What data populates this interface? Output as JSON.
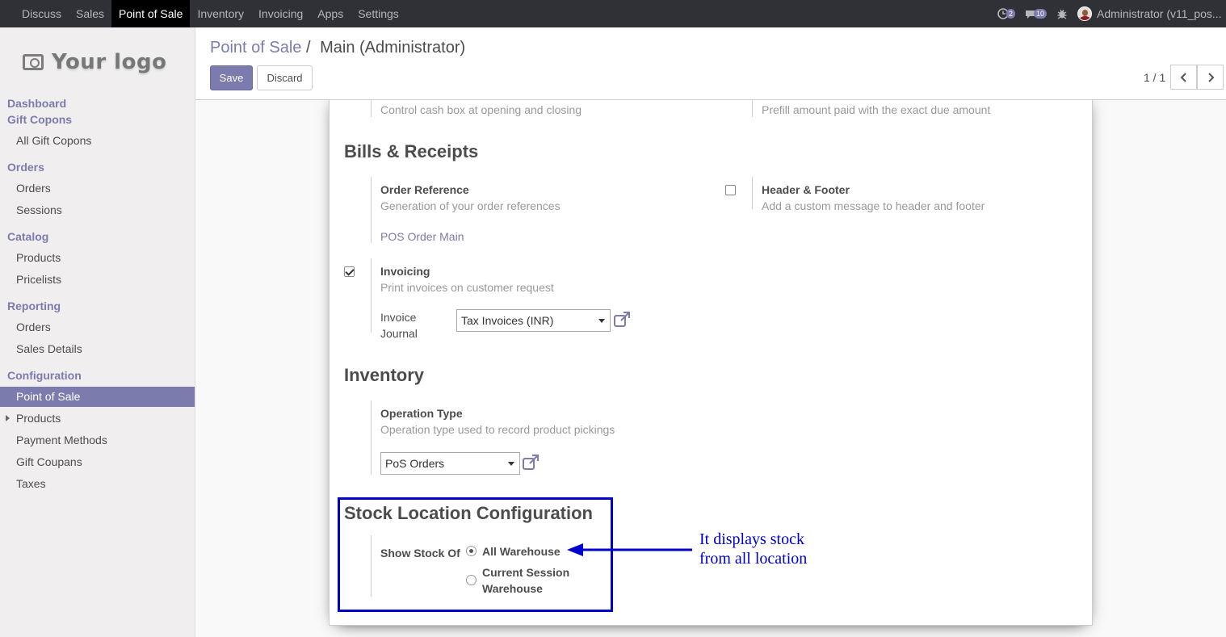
{
  "topbar": {
    "menu": [
      "Discuss",
      "Sales",
      "Point of Sale",
      "Inventory",
      "Invoicing",
      "Apps",
      "Settings"
    ],
    "active": "Point of Sale",
    "activity_count": "2",
    "message_count": "10",
    "user": "Administrator (v11_pos..."
  },
  "sidebar": {
    "logo_text": "Your logo",
    "dashboard": "Dashboard",
    "gift_copons": "Gift Copons",
    "all_gift_copons": "All Gift Copons",
    "orders_head": "Orders",
    "orders": "Orders",
    "sessions": "Sessions",
    "catalog_head": "Catalog",
    "products": "Products",
    "pricelists": "Pricelists",
    "reporting_head": "Reporting",
    "report_orders": "Orders",
    "sales_details": "Sales Details",
    "configuration_head": "Configuration",
    "point_of_sale": "Point of Sale",
    "config_products": "Products",
    "payment_methods": "Payment Methods",
    "gift_coupans": "Gift Coupans",
    "taxes": "Taxes"
  },
  "control": {
    "breadcrumb_parent": "Point of Sale",
    "breadcrumb_sep": "/",
    "breadcrumb_current": "Main (Administrator)",
    "save": "Save",
    "discard": "Discard",
    "pager": "1 / 1"
  },
  "form": {
    "top_help_left": "Control cash box at opening and closing",
    "top_help_right": "Prefill amount paid with the exact due amount",
    "bills_title": "Bills & Receipts",
    "order_ref_label": "Order Reference",
    "order_ref_help": "Generation of your order references",
    "order_ref_link": "POS Order Main",
    "header_footer_label": "Header & Footer",
    "header_footer_help": "Add a custom message to header and footer",
    "header_footer_checked": false,
    "invoicing_label": "Invoicing",
    "invoicing_help": "Print invoices on customer request",
    "invoicing_checked": true,
    "invoice_journal_label_1": "Invoice",
    "invoice_journal_label_2": "Journal",
    "invoice_journal_value": "Tax Invoices (INR)",
    "inventory_title": "Inventory",
    "operation_type_label": "Operation Type",
    "operation_type_help": "Operation type used to record product pickings",
    "operation_type_value": "PoS Orders",
    "stock_title": "Stock Location Configuration",
    "show_stock_label": "Show Stock Of",
    "option_all": "All Warehouse",
    "option_current_1": "Current Session",
    "option_current_2": "Warehouse",
    "selected_option": "All Warehouse"
  },
  "annotation": {
    "line1": "It displays stock",
    "line2": "from all location",
    "color": "#0000cc"
  },
  "colors": {
    "brand": "#7c7bad",
    "navbar": "#2f3136"
  }
}
